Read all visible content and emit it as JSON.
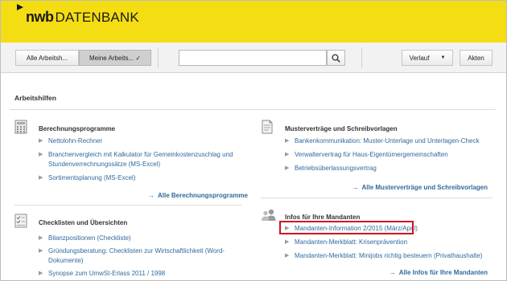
{
  "header": {
    "brand": "nwb",
    "product": "DATENBANK"
  },
  "toolbar": {
    "all_tools_label": "Alle Arbeitsh...",
    "my_tools_label": "Meine Arbeits... ✓",
    "search_value": "",
    "history_label": "Verlauf",
    "history_caret": "▼",
    "documents_label": "Akten"
  },
  "page": {
    "title": "Arbeitshilfen"
  },
  "sections": [
    {
      "title": "Berechnungsprogramme",
      "icon": "calculator-icon",
      "items": [
        [
          "Nettolohn-Rechner"
        ],
        [
          "Branchenvergleich mit Kalkulator für Gemeinkostenzuschlag und",
          "Stundenverrechnungssätze (MS-Excel)"
        ],
        [
          "Sortimentsplanung (MS-Excel)"
        ]
      ],
      "all_link": "Alle Berechnungsprogramme"
    },
    {
      "title": "Musterverträge und Schreibvorlagen",
      "icon": "document-icon",
      "items": [
        [
          "Bankenkommunikation: Muster-Unterlage und Unterlagen-Check"
        ],
        [
          "Verwaltervertrag für Haus-Eigentümergemeinschaften"
        ],
        [
          "Betriebsüberlassungsvertrag"
        ]
      ],
      "all_link": "Alle Musterverträge und Schreibvorlagen"
    },
    {
      "title": "Checklisten und Übersichten",
      "icon": "checklist-icon",
      "items": [
        [
          "Bilanzpositionen (Checkliste)"
        ],
        [
          "Gründungsberatung: Checklisten zur Wirtschaftlichkeit (Word-",
          "Dokumente)"
        ],
        [
          "Synopse zum UmwSt-Erlass 2011 / 1998"
        ]
      ]
    },
    {
      "title": "Infos für Ihre Mandanten",
      "icon": "users-icon",
      "items": [
        [
          "Mandanten-Information 2/2015 (März/April)"
        ],
        [
          "Mandanten-Merkblatt: Krisenprävention"
        ],
        [
          "Mandanten-Merkblatt: Minijobs richtig besteuern (Privathaushalte)"
        ]
      ],
      "all_link": "Alle Infos für Ihre Mandanten"
    }
  ],
  "icons": {
    "bullet": "▶",
    "link_arrow": "→"
  },
  "colors": {
    "brand_yellow": "#f5dd13",
    "link_blue": "#2f6a9e",
    "highlight_red": "#d3101e"
  }
}
